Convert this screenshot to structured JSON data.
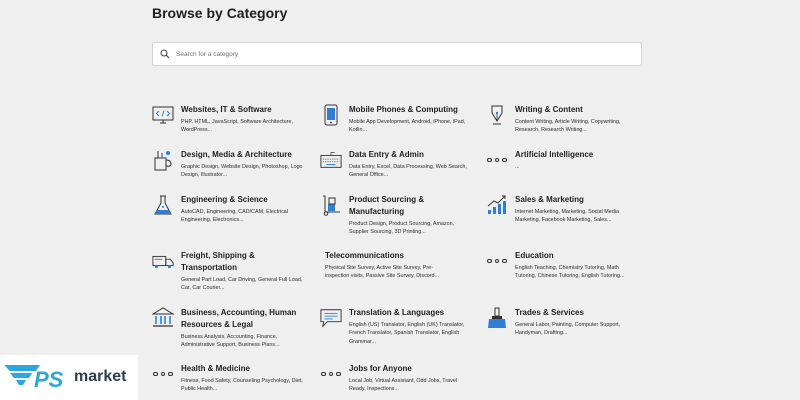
{
  "page": {
    "title": "Browse by Category",
    "search_placeholder": "Search for a category"
  },
  "categories": [
    {
      "title": "Websites, IT & Software",
      "sub": "PHP, HTML, JavaScript, Software Architecture, WordPress...",
      "icon": "monitor-code-icon"
    },
    {
      "title": "Mobile Phones & Computing",
      "sub": "Mobile App Development, Android, iPhone, iPad, Kotlin...",
      "icon": "mobile-phone-icon"
    },
    {
      "title": "Writing & Content",
      "sub": "Content Writing, Article Writing, Copywriting, Research, Research Writing...",
      "icon": "pen-nib-icon"
    },
    {
      "title": "Design, Media & Architecture",
      "sub": "Graphic Design, Website Design, Photoshop, Logo Design, Illustrator...",
      "icon": "design-tools-icon"
    },
    {
      "title": "Data Entry & Admin",
      "sub": "Data Entry, Excel, Data Processing, Web Search, General Office...",
      "icon": "keyboard-icon"
    },
    {
      "title": "Artificial Intelligence",
      "sub": "...",
      "icon": "dots-icon"
    },
    {
      "title": "Engineering & Science",
      "sub": "AutoCAD, Engineering, CAD/CAM, Electrical Engineering, Electronics...",
      "icon": "flask-icon"
    },
    {
      "title": "Product Sourcing & Manufacturing",
      "sub": "Product Design, Product Sourcing, Amazon, Supplier Sourcing, 3D Printing...",
      "icon": "hand-truck-icon"
    },
    {
      "title": "Sales & Marketing",
      "sub": "Internet Marketing, Marketing, Social Media Marketing, Facebook Marketing, Sales...",
      "icon": "growth-chart-icon"
    },
    {
      "title": "Freight, Shipping & Transportation",
      "sub": "General Part Load, Car Driving, General Full Load, Car, Car Courier...",
      "icon": "truck-icon"
    },
    {
      "title": "Telecommunications",
      "sub": "Physical Site Survey, Active Site Survey, Pre-inspection visits, Passive Site Survey, Discord...",
      "icon": ""
    },
    {
      "title": "Education",
      "sub": "English Teaching, Chemistry Tutoring, Math Tutoring, Chinese Tutoring, English Tutoring...",
      "icon": "dots-icon"
    },
    {
      "title": "Business, Accounting, Human Resources & Legal",
      "sub": "Business Analysis, Accounting, Finance, Administrative Support, Business Plans...",
      "icon": "bank-icon"
    },
    {
      "title": "Translation & Languages",
      "sub": "English (US) Translator, English (UK) Translator, French Translator, Spanish Translator, English Grammar...",
      "icon": "chat-bubble-icon"
    },
    {
      "title": "Trades & Services",
      "sub": "General Labor, Painting, Computer Support, Handyman, Drafting...",
      "icon": "paint-brush-icon"
    },
    {
      "title": "Health & Medicine",
      "sub": "Fitness, Food Safety, Counseling Psychology, Diet, Public Health...",
      "icon": "dots-icon"
    },
    {
      "title": "Jobs for Anyone",
      "sub": "Local Job, Virtual Assistant, Odd Jobs, Travel Ready, Inspections...",
      "icon": "dots-icon"
    }
  ],
  "logo": {
    "text": "market",
    "brand": "PS"
  },
  "colors": {
    "background": "#efefef",
    "icon_blue": "#2f7fd6",
    "text": "#1f1f1f"
  }
}
